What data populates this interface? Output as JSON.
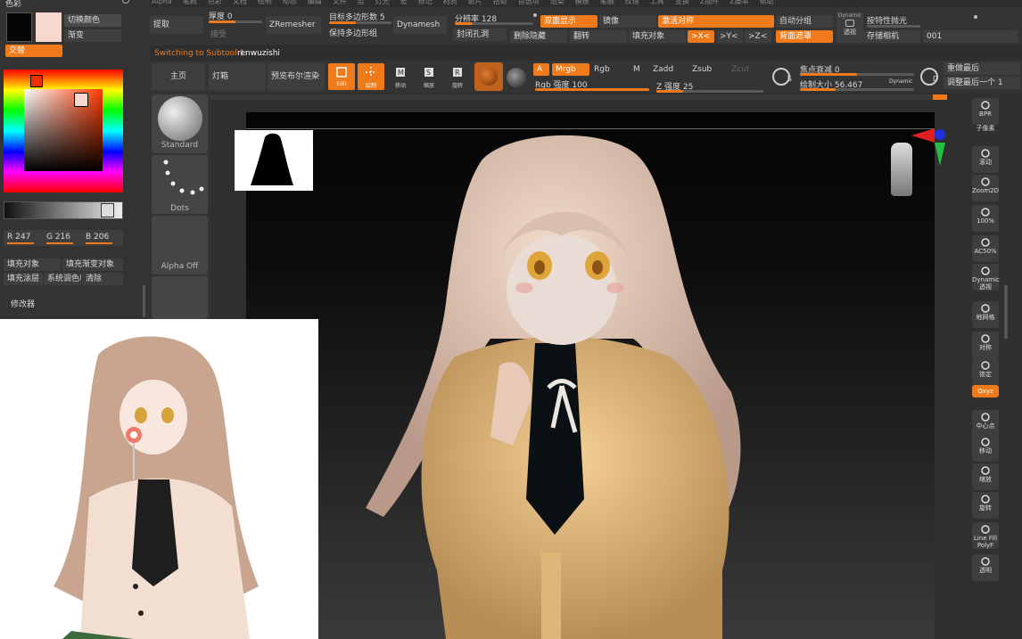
{
  "menu": [
    "Alpha",
    "笔刷",
    "色彩",
    "文档",
    "绘制",
    "动态",
    "编辑",
    "文件",
    "层",
    "灯光",
    "宏",
    "标记",
    "材质",
    "影片",
    "拾取",
    "首选项",
    "渲染",
    "模板",
    "笔触",
    "纹理",
    "工具",
    "变换",
    "Z插件",
    "Z脚本",
    "帮助"
  ],
  "color_panel": {
    "title": "色彩",
    "switch_color": "切换颜色",
    "gradient": "渐变",
    "alternate": "交替",
    "main_color": "#050505",
    "secondary_color": "#f7d8ce",
    "r_label": "R 247",
    "g_label": "G 216",
    "b_label": "B 206",
    "fill_object": "填充对象",
    "fill_gradient_object": "填充渐变对象",
    "fill_layer": "填充涂层",
    "system_palette": "系统调色板",
    "clear": "清除",
    "modifiers": "修改器"
  },
  "top_tools": {
    "extract": "提取",
    "thickness": "厚度 0",
    "accept": "接受",
    "zremesher": "ZRemesher",
    "target_polycount": "目标多边形数 5",
    "keep_groups": "保持多边形组",
    "dynamesh": "Dynamesh",
    "resolution": "分辨率 128",
    "close_holes": "封闭孔洞",
    "double_sided": "双面显示",
    "mirror": "镜像",
    "activate_symmetry": "激活对称",
    "auto_groups": "自动分组",
    "del_hidden": "删除隐藏",
    "flip": "翻转",
    "fill_object": "填充对象",
    "axis_x": ">X<",
    "axis_y": ">Y<",
    "axis_z": ">Z<",
    "backface_mask": "背面遮罩",
    "dynamic": "Dynamic",
    "perspective": "透视",
    "specular": "按特性抛光",
    "store_camera": "存储相机",
    "camera_value": "001"
  },
  "subtool_notice": {
    "prefix": "Switching to Subtool 1:",
    "name": "renwuzishi"
  },
  "toolbar2": {
    "home": "主页",
    "lightbox": "灯箱",
    "bpr_preview": "预览布尔渲染",
    "edit": "Edit",
    "draw": "绘制",
    "move": "移动",
    "scale": "缩放",
    "rotate": "旋转",
    "a": "A",
    "mrgb": "Mrgb",
    "rgb": "Rgb",
    "m": "M",
    "rgb_intensity": "Rgb 强度 100",
    "zadd": "Zadd",
    "zsub": "Zsub",
    "zcut": "Zcut",
    "z_intensity": "Z 强度 25",
    "focal_shift": "焦点衰减 0",
    "draw_size": "绘制大小 56.467",
    "dynamic": "Dynamic",
    "redo": "重做最后",
    "adjust_last": "调整最后一个 1",
    "s_label": "S",
    "d_label": "D"
  },
  "brushes": [
    {
      "label": "Standard"
    },
    {
      "label": "Dots"
    },
    {
      "label": "Alpha Off"
    }
  ],
  "right_shelf": [
    "BPR",
    "子像素",
    "滚动",
    "Zoom2D",
    "100%",
    "AC50%",
    "Dynamic 透视",
    "地网格",
    "对称",
    "锁定",
    "Qxyz",
    "中心点",
    "移动",
    "缩放",
    "旋转",
    "Line Fill PolyF",
    "透明"
  ],
  "colors": {
    "accent": "#f07a1a",
    "panel": "#3a3a3a",
    "viewport": "#2a2a2a"
  }
}
